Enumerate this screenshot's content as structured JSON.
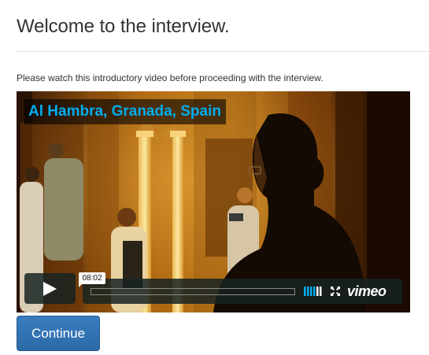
{
  "header": {
    "title": "Welcome to the interview."
  },
  "intro": {
    "text": "Please watch this introductory video before proceeding with the interview."
  },
  "video": {
    "title": "Al Hambra, Granada, Spain",
    "hover_time": "08:02",
    "logo_text": "vimeo",
    "title_color": "#00adef",
    "playback_progress": 0
  },
  "actions": {
    "continue_label": "Continue"
  },
  "colors": {
    "button_primary": "#337ab7",
    "video_overlay": "#172322"
  }
}
